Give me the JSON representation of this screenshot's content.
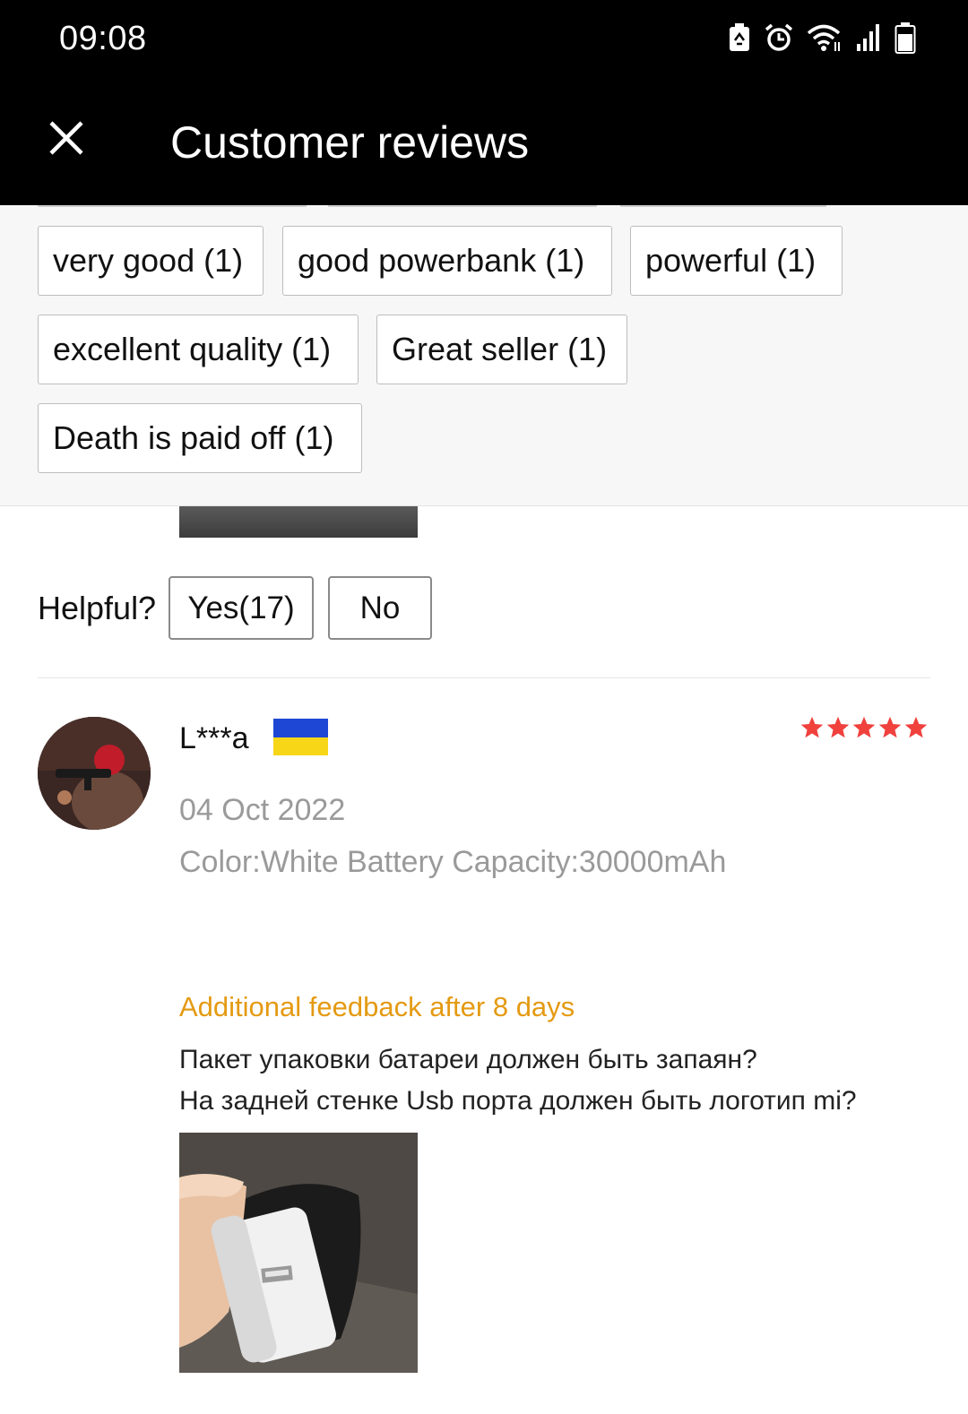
{
  "status_bar": {
    "time": "09:08",
    "icons": [
      "battery-saver-icon",
      "alarm-icon",
      "wifi-icon",
      "signal-icon",
      "battery-icon"
    ]
  },
  "header": {
    "title": "Customer reviews",
    "close_icon": "close-icon"
  },
  "tags": [
    "very good (1)",
    "good powerbank (1)",
    "powerful (1)",
    "excellent quality (1)",
    "Great seller (1)",
    "Death is paid off (1)"
  ],
  "previous_review": {
    "helpful_label": "Helpful?",
    "yes_label": "Yes(17)",
    "no_label": "No"
  },
  "review": {
    "reviewer": "L***a",
    "country_flag": "ukraine-flag",
    "rating": 5,
    "star_color": "#f0413d",
    "date": "04 Oct 2022",
    "sku": "Color:White Battery Capacity:30000mAh",
    "additional_label": "Additional feedback after 8 days",
    "additional_color": "#e49a12",
    "feedback_lines": [
      "Пакет упаковки батареи должен быть запаян?",
      "На задней стенке Usb порта должен быть логотип mi?"
    ]
  }
}
